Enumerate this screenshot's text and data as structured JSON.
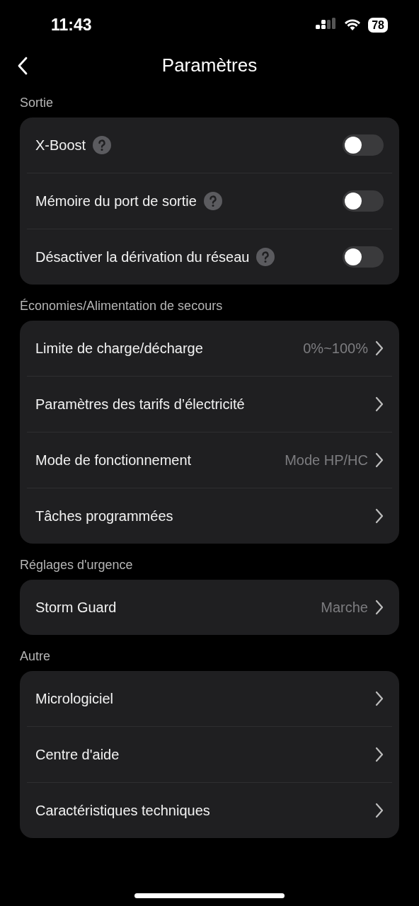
{
  "status_bar": {
    "time": "11:43",
    "battery": "78"
  },
  "header": {
    "title": "Paramètres"
  },
  "sections": [
    {
      "title": "Sortie",
      "rows": [
        {
          "kind": "toggle",
          "label": "X-Boost",
          "help": true,
          "on": false
        },
        {
          "kind": "toggle",
          "label": "Mémoire du port de sortie",
          "help": true,
          "on": false
        },
        {
          "kind": "toggle",
          "label": "Désactiver la dérivation du réseau",
          "help": true,
          "on": false
        }
      ]
    },
    {
      "title": "Économies/Alimentation de secours",
      "rows": [
        {
          "kind": "link",
          "label": "Limite de charge/décharge",
          "value": "0%~100%"
        },
        {
          "kind": "link",
          "label": "Paramètres des tarifs d’électricité"
        },
        {
          "kind": "link",
          "label": "Mode de fonctionnement",
          "value": "Mode HP/HC"
        },
        {
          "kind": "link",
          "label": "Tâches programmées"
        }
      ]
    },
    {
      "title": "Réglages d'urgence",
      "rows": [
        {
          "kind": "link",
          "label": "Storm Guard",
          "value": "Marche"
        }
      ]
    },
    {
      "title": "Autre",
      "rows": [
        {
          "kind": "link",
          "label": "Micrologiciel"
        },
        {
          "kind": "link",
          "label": "Centre d'aide"
        },
        {
          "kind": "link",
          "label": "Caractéristiques techniques"
        }
      ]
    }
  ]
}
